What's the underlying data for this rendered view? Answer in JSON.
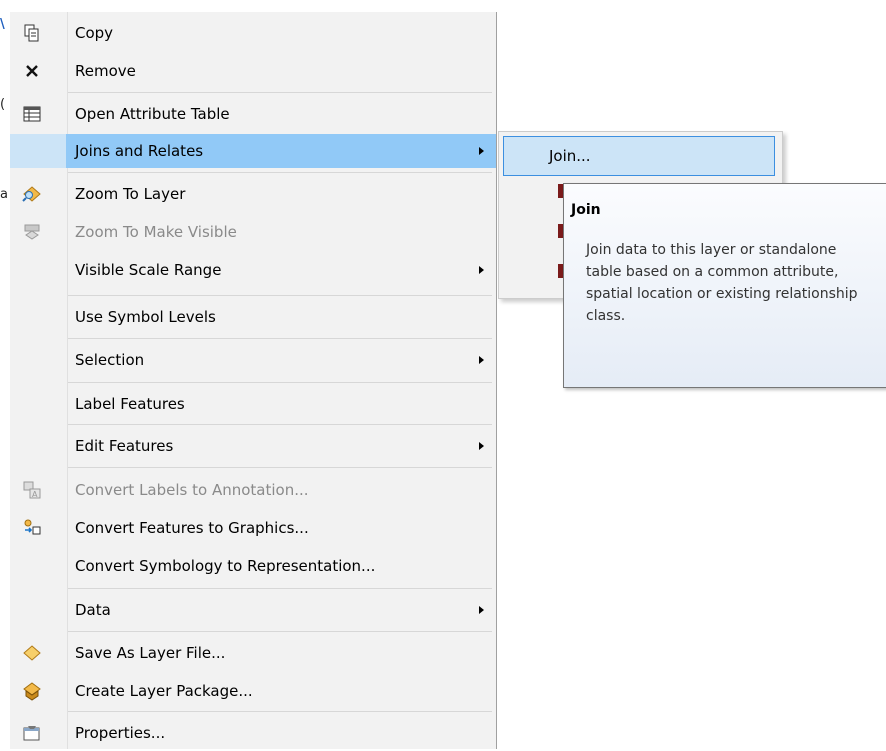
{
  "menu": {
    "items": [
      {
        "label": "Copy",
        "icon": "copy-icon"
      },
      {
        "label": "Remove",
        "icon": "remove-x-icon"
      },
      {
        "label": "Open Attribute Table",
        "icon": "table-icon"
      },
      {
        "label": "Joins and Relates",
        "icon": "",
        "submenu": true,
        "highlighted": true
      },
      {
        "label": "Zoom To Layer",
        "icon": "zoom-to-layer-icon"
      },
      {
        "label": "Zoom To Make Visible",
        "icon": "zoom-make-visible-icon",
        "disabled": true
      },
      {
        "label": "Visible Scale Range",
        "icon": "",
        "submenu": true
      },
      {
        "label": "Use Symbol Levels",
        "icon": ""
      },
      {
        "label": "Selection",
        "icon": "",
        "submenu": true
      },
      {
        "label": "Label Features",
        "icon": ""
      },
      {
        "label": "Edit Features",
        "icon": "",
        "submenu": true
      },
      {
        "label": "Convert Labels to Annotation...",
        "icon": "convert-labels-icon",
        "disabled": true
      },
      {
        "label": "Convert Features to Graphics...",
        "icon": "convert-features-icon"
      },
      {
        "label": "Convert Symbology to Representation...",
        "icon": ""
      },
      {
        "label": "Data",
        "icon": "",
        "submenu": true
      },
      {
        "label": "Save As Layer File...",
        "icon": "layer-file-icon"
      },
      {
        "label": "Create Layer Package...",
        "icon": "layer-package-icon"
      },
      {
        "label": "Properties...",
        "icon": "properties-icon"
      }
    ]
  },
  "submenu": {
    "items": [
      {
        "label": "Join...",
        "highlighted": true
      }
    ]
  },
  "tooltip": {
    "title": "Join",
    "body": "Join data to this layer or standalone table based on a common attribute, spatial location or existing relationship class."
  },
  "colors": {
    "menu_bg": "#f2f2f2",
    "highlight": "#91c9f7",
    "highlight_border": "#3c8fe0"
  }
}
